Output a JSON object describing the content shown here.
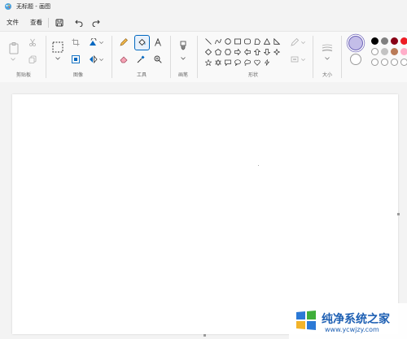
{
  "window": {
    "title": "无标题 - 画图"
  },
  "menu": {
    "file": "文件",
    "view": "查看"
  },
  "ribbon": {
    "groups": {
      "clipboard": "剪贴板",
      "image": "图像",
      "tools": "工具",
      "brushes": "画笔",
      "shapes": "形状",
      "size": "大小"
    }
  },
  "colors": {
    "primary": "#c3bde8",
    "secondary": "#ffffff",
    "palette_row1": [
      "#000000",
      "#7f7f7f",
      "#880015",
      "#ed1c24"
    ],
    "palette_row2": [
      "#ffffff",
      "#c3c3c3",
      "#b97a57",
      "#ffaec9"
    ],
    "accent": "#0067c0"
  },
  "watermark": {
    "brand": "纯净系统之家",
    "url": "www.ycwjzy.com"
  }
}
